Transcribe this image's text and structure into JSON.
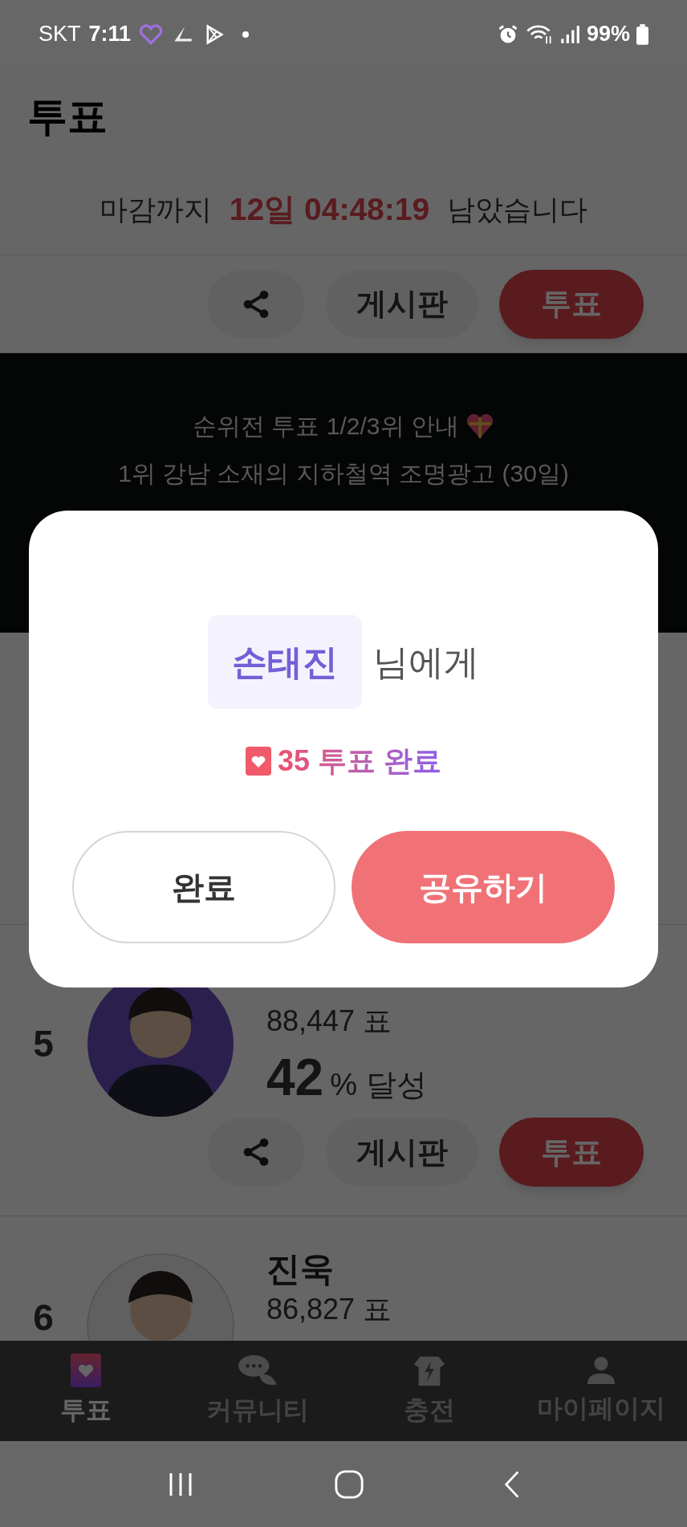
{
  "status_bar": {
    "carrier": "SKT",
    "time": "7:11",
    "battery": "99%"
  },
  "header": {
    "title": "투표"
  },
  "countdown": {
    "prefix": "마감까지",
    "remaining": "12일 04:48:19",
    "suffix": "남았습니다"
  },
  "top_actions": {
    "board": "게시판",
    "vote": "투표"
  },
  "banner": {
    "lines": [
      "순위전 투표 1/2/3위 안내",
      "1위 강남 소재의 지하철역 조명광고 (30일)"
    ]
  },
  "candidates": [
    {
      "rank": "5",
      "votes": "88,447 표",
      "percent": "42",
      "percent_suffix": "% 달성",
      "board": "게시판",
      "vote": "투표"
    },
    {
      "rank": "6",
      "name": "진욱",
      "votes": "86,827 표"
    }
  ],
  "bottom_nav": [
    {
      "label": "투표",
      "selected": true
    },
    {
      "label": "커뮤니티",
      "selected": false
    },
    {
      "label": "충전",
      "selected": false
    },
    {
      "label": "마이페이지",
      "selected": false
    }
  ],
  "dialog": {
    "recipient": "손태진",
    "recipient_suffix": "님에게",
    "result": "35 투표 완료",
    "buttons": [
      {
        "label": "완료",
        "kind": "secondary"
      },
      {
        "label": "공유하기",
        "kind": "primary"
      }
    ]
  }
}
